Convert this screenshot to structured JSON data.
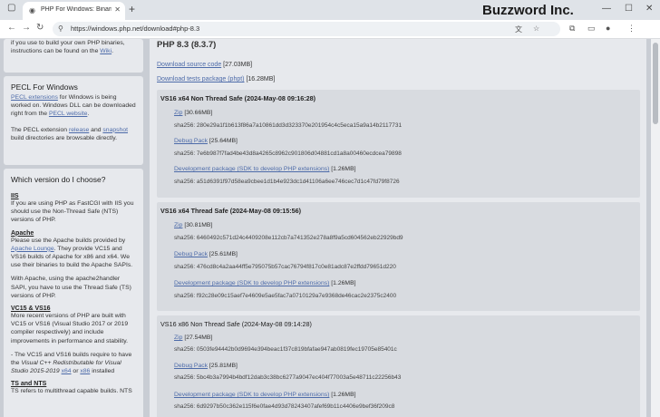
{
  "browser": {
    "tab_title": "PHP For Windows: Binaries and s",
    "url": "https://windows.php.net/download#php-8.3",
    "brand": "Buzzword Inc."
  },
  "sidebar": {
    "intro_top_line": "if you use to build your own PHP binaries,",
    "intro_second_line": "instructions can be found on the",
    "intro_wiki_link": "Wiki",
    "pecl_heading": "PECL For Windows",
    "pecl_link1": "PECL extensions",
    "pecl_text1": "for Windows is being worked on. Windows DLL can be downloaded right from the",
    "pecl_link2": "PECL website",
    "pecl_text2": "The PECL extension",
    "pecl_link3": "release",
    "pecl_and": "and",
    "pecl_link4": "snapshot",
    "pecl_text3": "build directories are browsable directly.",
    "which_heading": "Which version do I choose?",
    "iis_heading": "IIS",
    "iis_text": "If you are using PHP as FastCGI with IIS you should use the Non-Thread Safe (NTS) versions of PHP.",
    "apache_heading": "Apache",
    "apache_text1": "Please use the Apache builds provided by",
    "apache_link": "Apache Lounge",
    "apache_text2": ". They provide VC15 and VS16 builds of Apache for x86 and x64. We use their binaries to build the Apache SAPIs.",
    "apache_text3": "With Apache, using the apache2handler SAPI, you have to use the Thread Safe (TS) versions of PHP.",
    "vc_heading": "VC15 & VS16",
    "vc_text1": "More recent versions of PHP are built with VC15 or VS16 (Visual Studio 2017 or 2019 compiler respectively) and include improvements in performance and stability.",
    "vc_text2a": "- The VC15 and VS16 builds require to have the",
    "vc_text2b": "Visual C++ Redistributable for Visual Studio 2015-2019",
    "vc_link_x64": "x64",
    "vc_or": "or",
    "vc_link_x86": "x86",
    "vc_installed": "installed",
    "ts_heading": "TS and NTS",
    "ts_text": "TS refers to multithread capable builds. NTS"
  },
  "main": {
    "heading": "PHP 8.3 (8.3.7)",
    "source_link": "Download source code",
    "source_size": "[27.03MB]",
    "tests_link": "Download tests package (phpt)",
    "tests_size": "[16.28MB]",
    "builds": [
      {
        "title": "VS16 x64 Non Thread Safe (2024-May-08 09:16:28)",
        "zip_size": "[30.66MB]",
        "zip_sha": "sha256: 280e29a1f1b613f86a7a10861dd3d323370e201954c4c5eca15a9a14b2117731",
        "debug_size": "[25.64MB]",
        "debug_sha": "sha256: 7e6b987f7fad4be43d8a4265c8962c901806d04881cd1a8a00460ecdcea79898",
        "dev_size": "[1.26MB]",
        "dev_sha": "sha256: a51d6391f97d58ea9cbee1d1b4e923dc1d41106a6ee746cec7d1c47fd79f8726"
      },
      {
        "title": "VS16 x64 Thread Safe (2024-May-08 09:15:56)",
        "zip_size": "[30.81MB]",
        "zip_sha": "sha256: 6460492c571d24c4409208e112cb7a741352e278a8f9a5cd604562eb22929bd9",
        "debug_size": "[25.61MB]",
        "debug_sha": "sha256: 476cd8c4a2aa44ff5e795075b57cac76794f817c0e81adc87e2ffdd79651d220",
        "dev_size": "[1.26MB]",
        "dev_sha": "sha256: f92c28e09c15aef7e4609e5ae5fac7a0710129a7e9368de46cac2e2375c2400"
      },
      {
        "title": "VS16 x86 Non Thread Safe (2024-May-08 09:14:28)",
        "zip_size": "[27.54MB]",
        "zip_sha": "sha256: 0503fe94442b0d9694e394beac1f37c819bfafae947ab0819fec19705e85401c",
        "debug_size": "[25.81MB]",
        "debug_sha": "sha256: 5bc4b3a7994b4bdf12dab3c38bc6277a9047ec404f77003a5e48711c22256b43",
        "dev_size": "[1.26MB]",
        "dev_sha": "sha256: 6d9297b50c362e115f6e0fae4d93d78243407afef69b11c4406e9bef36f209c8"
      }
    ],
    "zip_label": "Zip",
    "debug_label": "Debug Pack",
    "dev_label": "Development package (SDK to develop PHP extensions)"
  },
  "colors": {
    "link": "#4d6ba9",
    "sidebar_bg": "#e7e9ed",
    "page_bg": "#c9cdd4",
    "card_bg": "#d8dbe0"
  }
}
